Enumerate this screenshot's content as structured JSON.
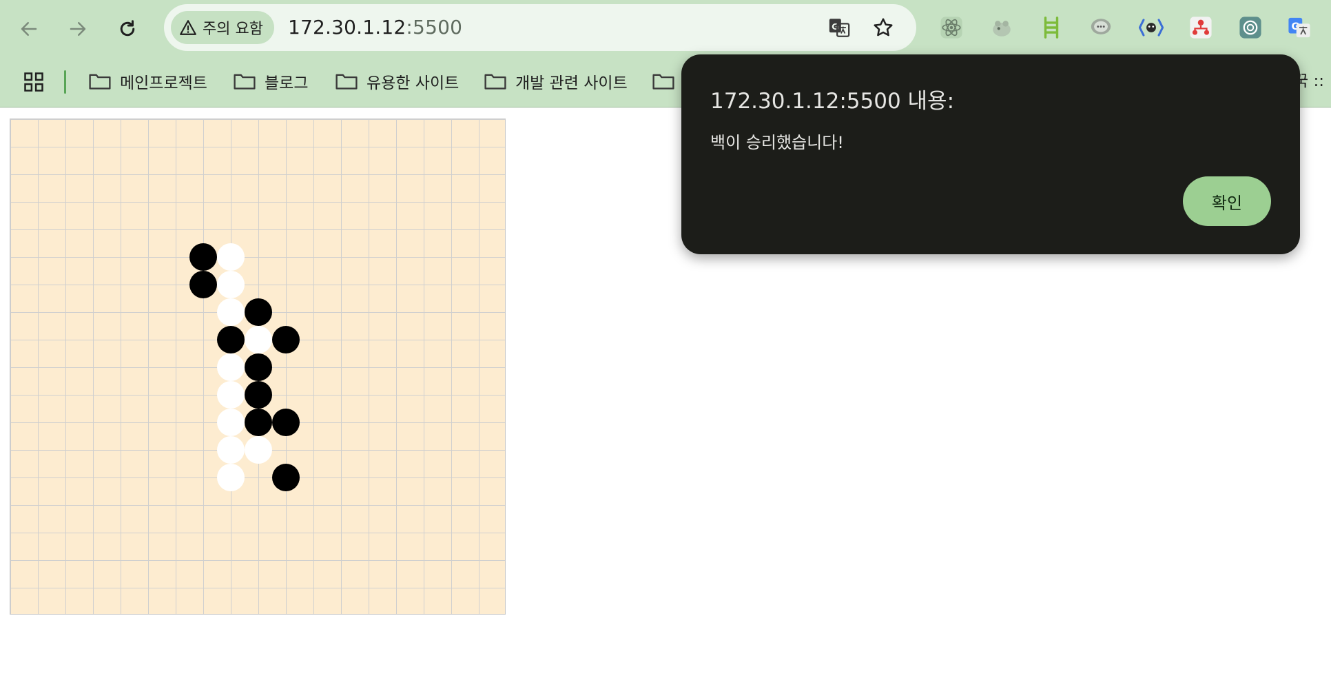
{
  "browser": {
    "security_chip": "주의 요함",
    "url_host": "172.30.1.12",
    "url_port": ":5500"
  },
  "bookmarks": {
    "items": [
      "메인프로젝트",
      "블로그",
      "유용한 사이트",
      "개발 관련 사이트"
    ],
    "trailing_text": "꾹 ::"
  },
  "game": {
    "grid_size": 18,
    "stones": [
      {
        "color": "black",
        "col": 7,
        "row": 5
      },
      {
        "color": "white",
        "col": 8,
        "row": 5
      },
      {
        "color": "black",
        "col": 7,
        "row": 6
      },
      {
        "color": "white",
        "col": 8,
        "row": 6
      },
      {
        "color": "white",
        "col": 8,
        "row": 7
      },
      {
        "color": "black",
        "col": 9,
        "row": 7
      },
      {
        "color": "black",
        "col": 8,
        "row": 8
      },
      {
        "color": "white",
        "col": 9,
        "row": 8
      },
      {
        "color": "black",
        "col": 10,
        "row": 8
      },
      {
        "color": "white",
        "col": 8,
        "row": 9
      },
      {
        "color": "black",
        "col": 9,
        "row": 9
      },
      {
        "color": "white",
        "col": 8,
        "row": 10
      },
      {
        "color": "black",
        "col": 9,
        "row": 10
      },
      {
        "color": "white",
        "col": 8,
        "row": 11
      },
      {
        "color": "black",
        "col": 9,
        "row": 11
      },
      {
        "color": "black",
        "col": 10,
        "row": 11
      },
      {
        "color": "white",
        "col": 8,
        "row": 12
      },
      {
        "color": "white",
        "col": 9,
        "row": 12
      },
      {
        "color": "white",
        "col": 8,
        "row": 13
      },
      {
        "color": "black",
        "col": 10,
        "row": 13
      }
    ]
  },
  "dialog": {
    "title": "172.30.1.12:5500 내용:",
    "message": "백이 승리했습니다!",
    "ok_label": "확인"
  },
  "colors": {
    "chrome_bg": "#c7e2c4",
    "board_bg": "#fdecd0",
    "dialog_bg": "#1c1d19",
    "ok_button": "#9ccf92"
  }
}
